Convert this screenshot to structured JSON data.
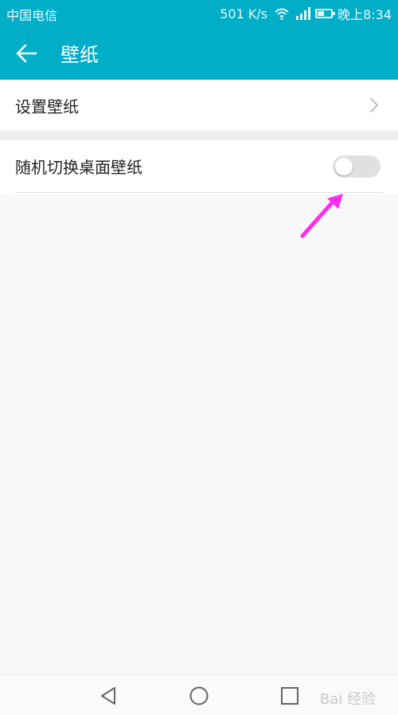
{
  "status_bar": {
    "carrier": "中国电信",
    "speed": "501 K/s",
    "time": "晚上8:34",
    "battery_level_percent": 50
  },
  "app_bar": {
    "title": "壁纸",
    "back_icon": "arrow-left-icon"
  },
  "settings": {
    "set_wallpaper_label": "设置壁纸",
    "random_switch_label": "随机切换桌面壁纸",
    "random_switch_on": false
  },
  "navigation": {
    "back": "triangle-back-icon",
    "home": "circle-home-icon",
    "recent": "square-recent-icon"
  },
  "watermark": "Bai 经验",
  "colors": {
    "accent": "#00aec7",
    "arrow": "#ff2cf0"
  }
}
